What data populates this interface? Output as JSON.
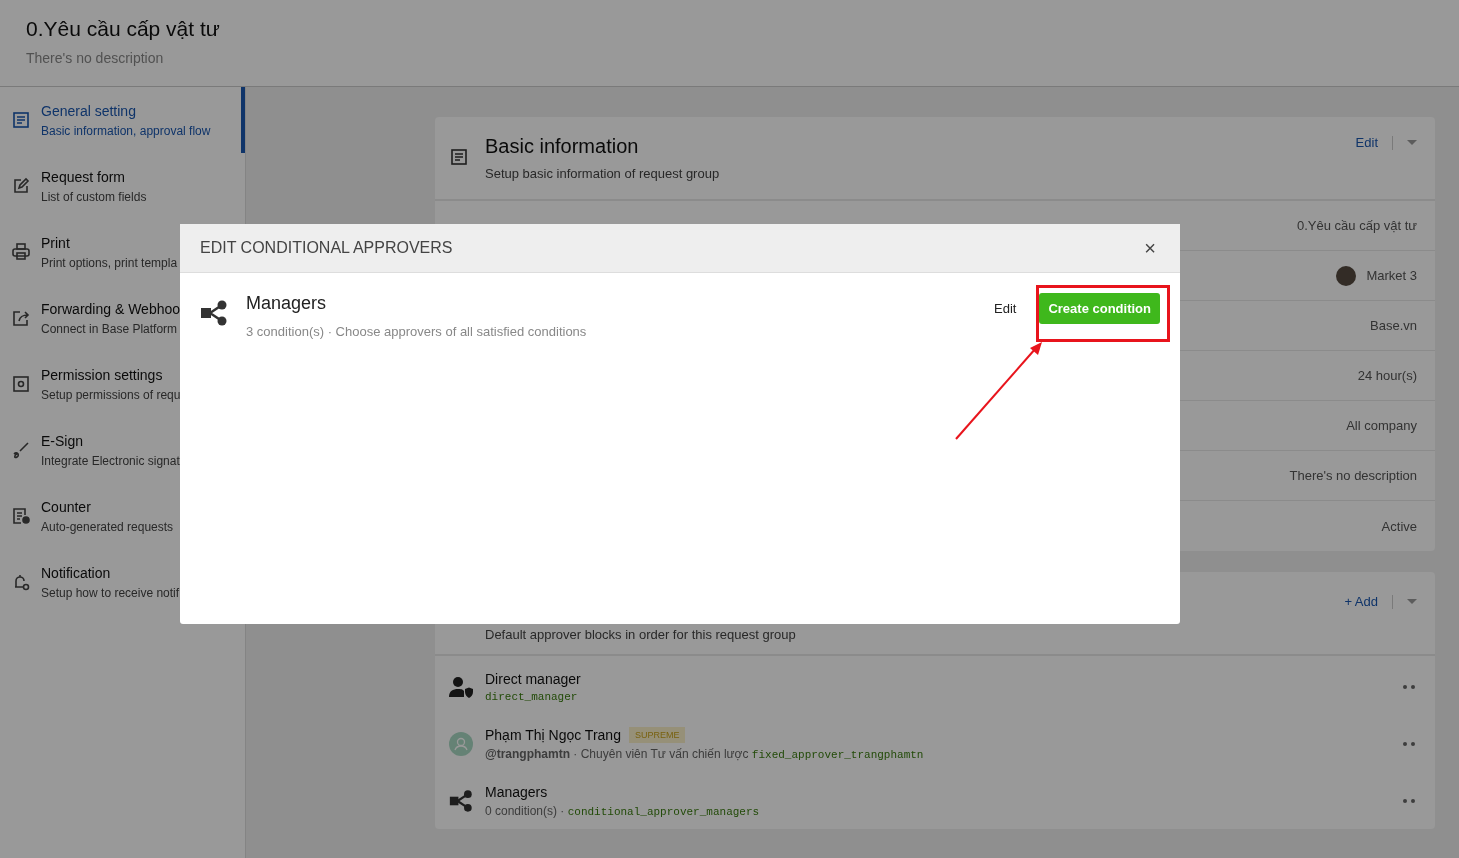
{
  "header": {
    "title": "0.Yêu cầu cấp vật tư",
    "description": "There's no description"
  },
  "sidebar": {
    "items": [
      {
        "title": "General setting",
        "subtitle": "Basic information, approval flow",
        "selected": true
      },
      {
        "title": "Request form",
        "subtitle": "List of custom fields",
        "selected": false
      },
      {
        "title": "Print",
        "subtitle": "Print options, print templa",
        "selected": false
      },
      {
        "title": "Forwarding & Webhoo",
        "subtitle": "Connect in Base Platform",
        "selected": false
      },
      {
        "title": "Permission settings",
        "subtitle": "Setup permissions of requ",
        "selected": false
      },
      {
        "title": "E-Sign",
        "subtitle": "Integrate Electronic signat",
        "selected": false
      },
      {
        "title": "Counter",
        "subtitle": "Auto-generated requests",
        "selected": false
      },
      {
        "title": "Notification",
        "subtitle": "Setup how to receive notif",
        "selected": false
      }
    ]
  },
  "basic_information": {
    "title": "Basic information",
    "subtitle": "Setup basic information of request group",
    "action": "Edit",
    "rows": [
      {
        "kind": "text",
        "value": "0.Yêu cầu cấp vật tư"
      },
      {
        "kind": "user",
        "value": "Market 3"
      },
      {
        "kind": "text",
        "value": "Base.vn"
      },
      {
        "kind": "text",
        "value": "24 hour(s)"
      },
      {
        "kind": "text",
        "value": "All company"
      },
      {
        "kind": "text",
        "value": "There's no description"
      },
      {
        "kind": "text",
        "value": "Active"
      }
    ]
  },
  "approval_flow": {
    "subtitle": "Default approver blocks in order for this request group",
    "action": "+ Add",
    "items": [
      {
        "kind": "role",
        "title": "Direct manager",
        "code": "direct_manager"
      },
      {
        "kind": "person",
        "title": "Phạm Thị Ngọc Trang",
        "badge": "SUPREME",
        "handle": "@trangphamtn",
        "detail": " · Chuyên viên Tư vấn chiến lược ",
        "code": "fixed_approver_trangphamtn"
      },
      {
        "kind": "conditional",
        "title": "Managers",
        "detail": "0 condition(s) · ",
        "code": "conditional_approver_managers"
      }
    ]
  },
  "modal": {
    "title": "EDIT CONDITIONAL APPROVERS",
    "close": "×",
    "item": {
      "title": "Managers",
      "subtitle": "3 condition(s) · Choose approvers of all satisfied conditions",
      "edit": "Edit",
      "create": "Create condition"
    }
  }
}
